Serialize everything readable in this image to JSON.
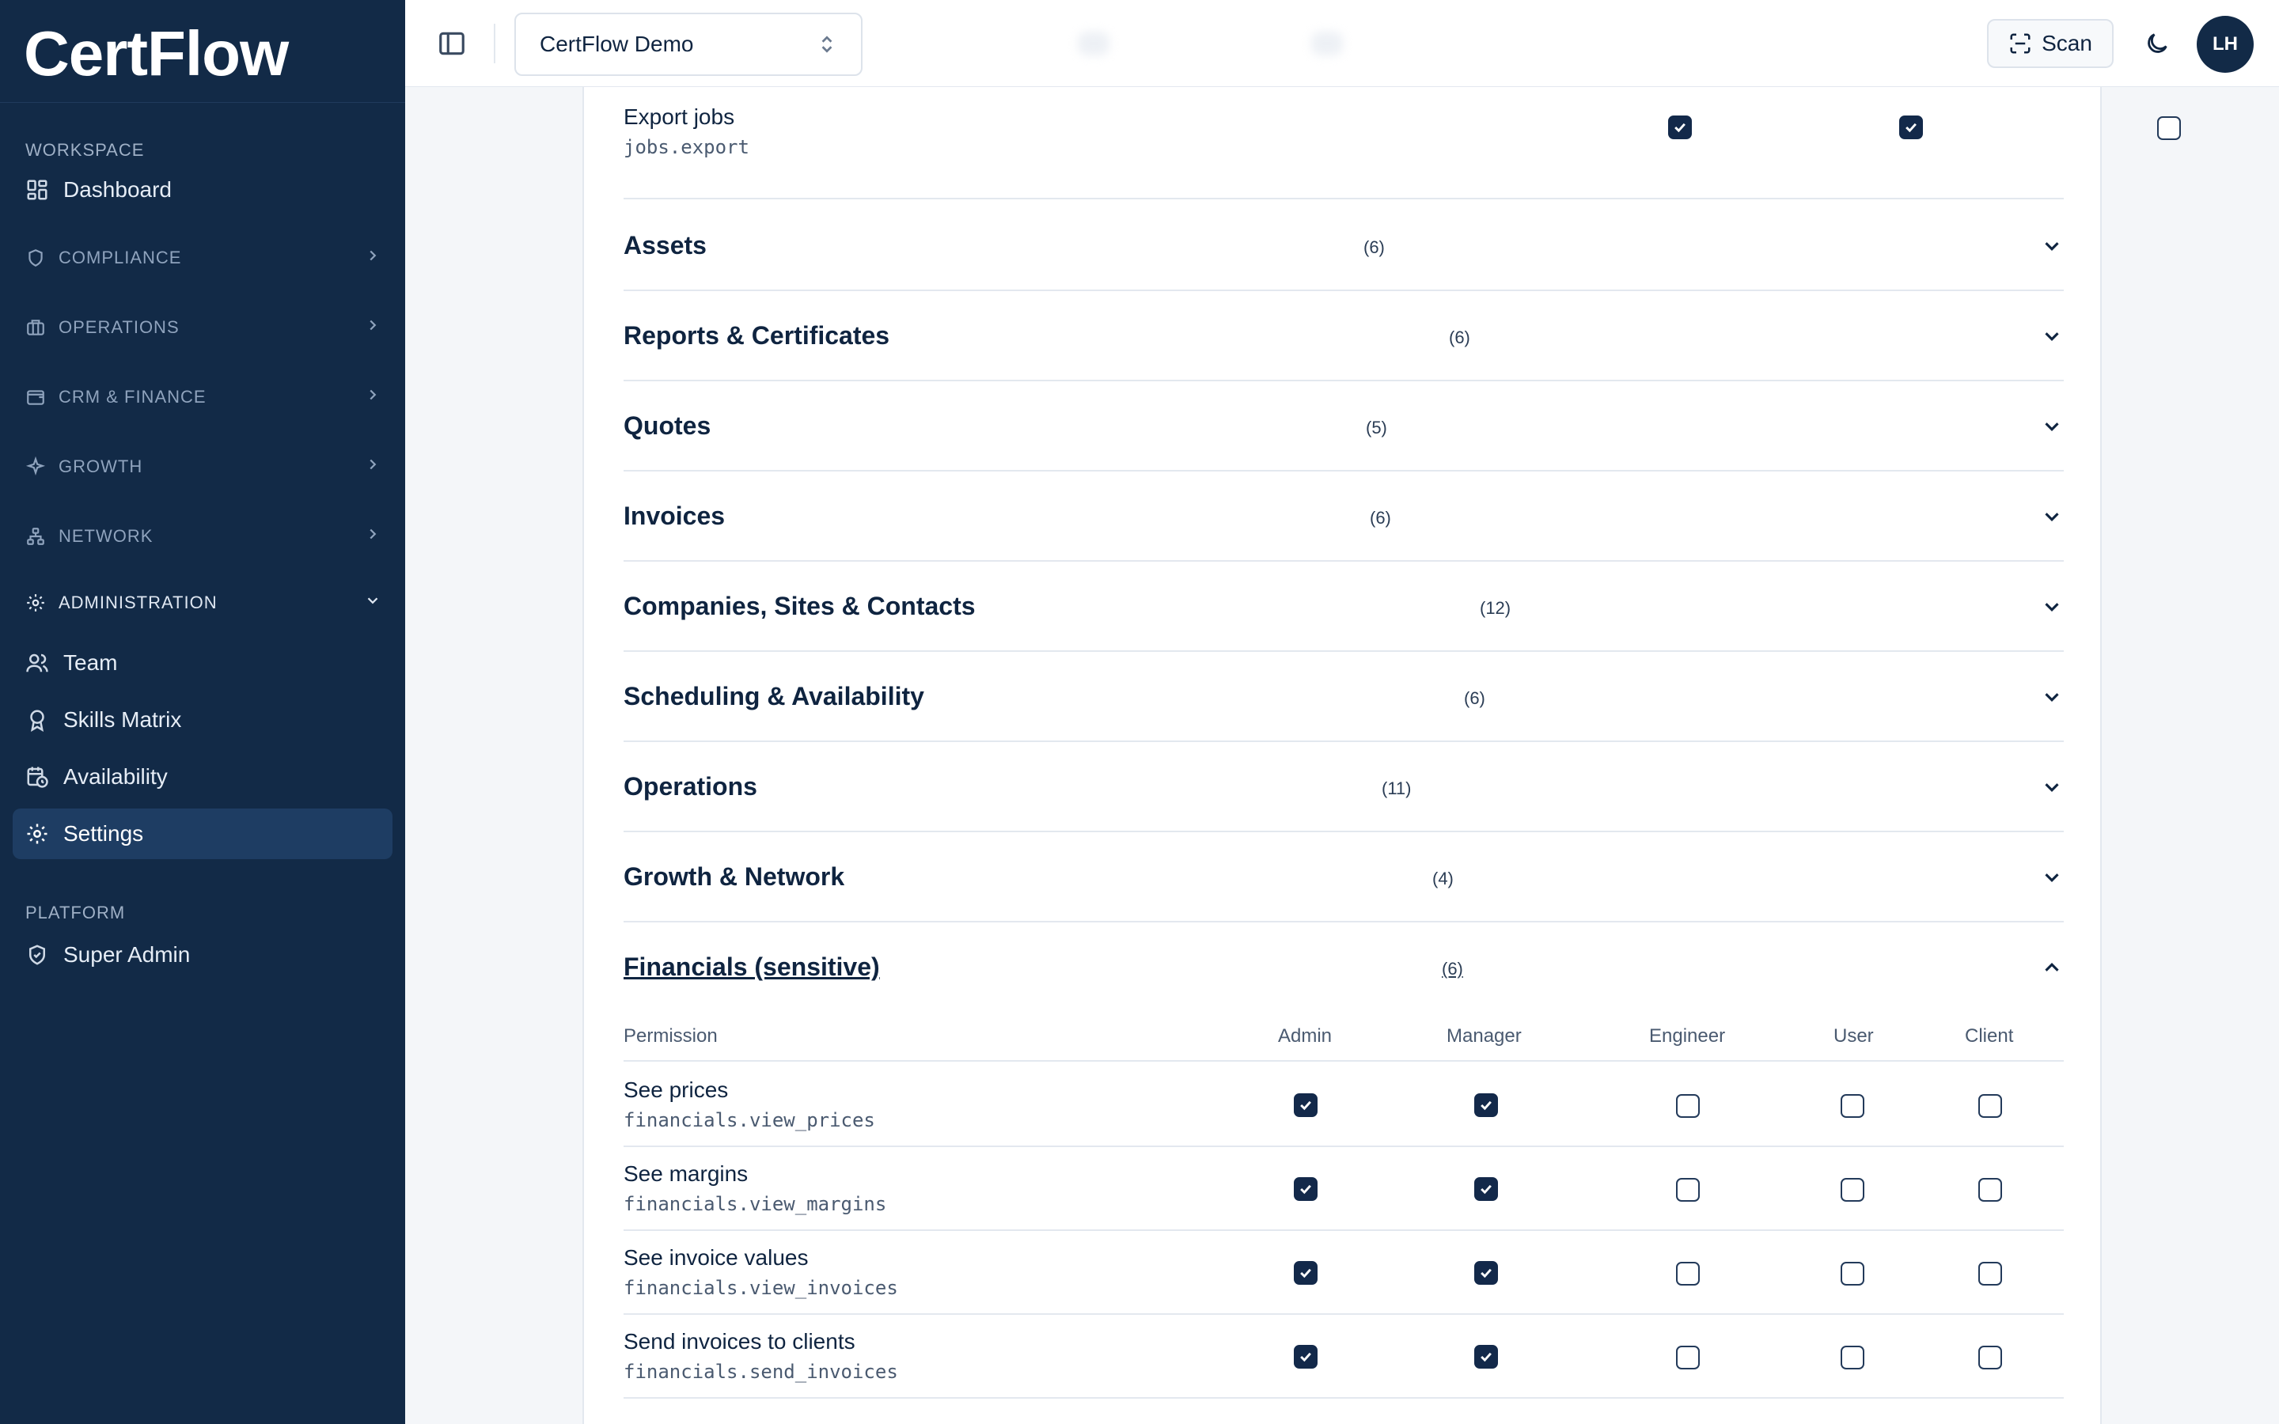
{
  "brand": {
    "name": "CertFlow"
  },
  "sidebar": {
    "workspace_label": "WORKSPACE",
    "dashboard": "Dashboard",
    "groups": [
      {
        "label": "COMPLIANCE",
        "icon": "shield-icon"
      },
      {
        "label": "OPERATIONS",
        "icon": "briefcase-icon"
      },
      {
        "label": "CRM & FINANCE",
        "icon": "wallet-icon"
      },
      {
        "label": "GROWTH",
        "icon": "sparkle-icon"
      },
      {
        "label": "NETWORK",
        "icon": "network-icon"
      }
    ],
    "admin_label": "ADMINISTRATION",
    "admin_items": [
      "Team",
      "Skills Matrix",
      "Availability",
      "Settings"
    ],
    "active_item": "Settings",
    "platform_label": "PLATFORM",
    "super_admin": "Super Admin"
  },
  "topbar": {
    "workspace_select": "CertFlow Demo",
    "scan_label": "Scan",
    "avatar_initials": "LH"
  },
  "top_permission": {
    "name": "Export jobs",
    "key": "jobs.export",
    "checks": [
      true,
      true,
      false,
      false,
      false
    ]
  },
  "accordions": [
    {
      "title": "Assets",
      "count": "(6)"
    },
    {
      "title": "Reports & Certificates",
      "count": "(6)"
    },
    {
      "title": "Quotes",
      "count": "(5)"
    },
    {
      "title": "Invoices",
      "count": "(6)"
    },
    {
      "title": "Companies, Sites & Contacts",
      "count": "(12)"
    },
    {
      "title": "Scheduling & Availability",
      "count": "(6)"
    },
    {
      "title": "Operations",
      "count": "(11)"
    },
    {
      "title": "Growth & Network",
      "count": "(4)"
    },
    {
      "title": "Financials (sensitive)",
      "count": "(6)",
      "open": true
    }
  ],
  "table": {
    "headers": [
      "Permission",
      "Admin",
      "Manager",
      "Engineer",
      "User",
      "Client"
    ],
    "rows": [
      {
        "name": "See prices",
        "key": "financials.view_prices",
        "checks": [
          true,
          true,
          false,
          false,
          false
        ]
      },
      {
        "name": "See margins",
        "key": "financials.view_margins",
        "checks": [
          true,
          true,
          false,
          false,
          false
        ]
      },
      {
        "name": "See invoice values",
        "key": "financials.view_invoices",
        "checks": [
          true,
          true,
          false,
          false,
          false
        ]
      },
      {
        "name": "Send invoices to clients",
        "key": "financials.send_invoices",
        "checks": [
          true,
          true,
          false,
          false,
          false
        ]
      }
    ]
  }
}
